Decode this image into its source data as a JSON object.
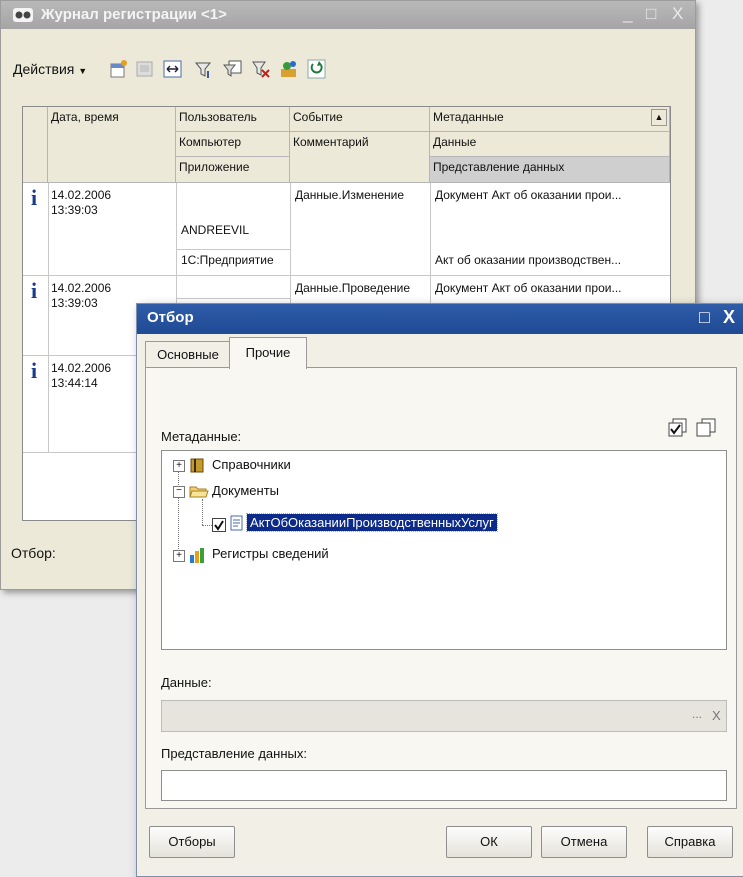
{
  "log_window": {
    "title": "Журнал регистрации <1>",
    "minimize_glyph": "_",
    "maximize_glyph": "□",
    "close_glyph": "X",
    "actions_label": "Действия",
    "filter_label": "Отбор:",
    "columns": {
      "datetime": "Дата, время",
      "user": "Пользователь",
      "computer": "Компьютер",
      "application": "Приложение",
      "event": "Событие",
      "comment": "Комментарий",
      "metadata": "Метаданные",
      "data": "Данные",
      "data_presentation": "Представление данных"
    },
    "rows": [
      {
        "icon": "i",
        "date": "14.02.2006",
        "time": "13:39:03",
        "user": "ANDREEVIL",
        "application": "1С:Предприятие",
        "event": "Данные.Изменение",
        "metadata": "Документ Акт об оказании прои...",
        "data_presentation": "Акт об оказании производствен..."
      },
      {
        "icon": "i",
        "date": "14.02.2006",
        "time": "13:39:03",
        "event": "Данные.Проведение",
        "metadata": "Документ Акт об оказании прои..."
      },
      {
        "icon": "i",
        "date": "14.02.2006",
        "time": "13:44:14"
      }
    ]
  },
  "dialog": {
    "title": "Отбор",
    "maximize_glyph": "□",
    "close_glyph": "X",
    "tabs": [
      "Основные",
      "Прочие"
    ],
    "metadata_label": "Метаданные:",
    "tree": [
      {
        "expander": "+",
        "label": "Справочники"
      },
      {
        "expander": "−",
        "label": "Документы"
      },
      {
        "label": "АктОбОказанииПроизводственныхУслуг",
        "checked": true
      },
      {
        "expander": "+",
        "label": "Регистры сведений"
      }
    ],
    "data_label": "Данные:",
    "data_value": "",
    "data_dots": "...",
    "data_clear": "X",
    "presentation_label": "Представление данных:",
    "presentation_value": "",
    "buttons": {
      "filters": "Отборы",
      "ok": "ОК",
      "cancel": "Отмена",
      "help": "Справка"
    }
  }
}
